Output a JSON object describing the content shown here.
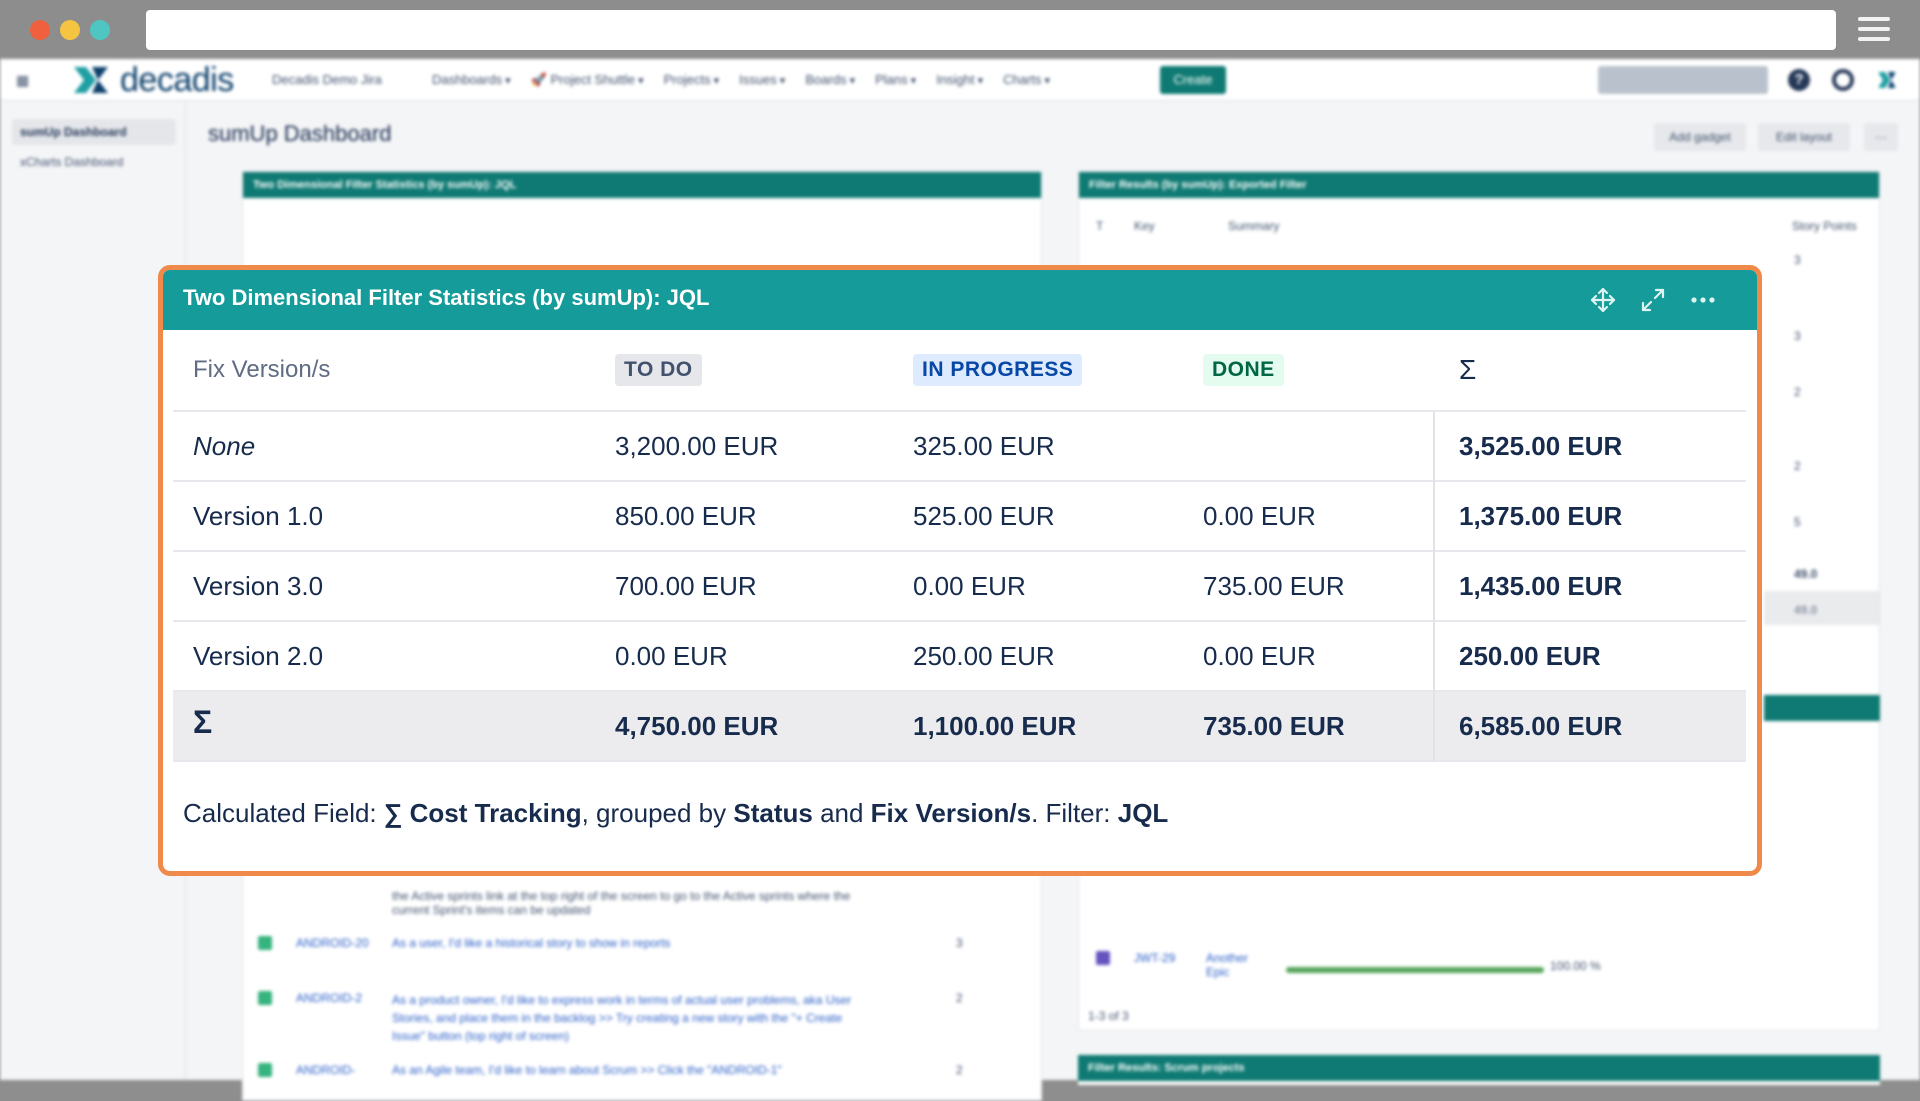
{
  "header": {
    "site_name": "Decadis Demo Jira",
    "logo_text": "decadis",
    "nav": [
      "Dashboards",
      "🚀 Project Shuttle",
      "Projects",
      "Issues",
      "Boards",
      "Plans",
      "Insight",
      "Charts"
    ],
    "create_label": "Create"
  },
  "sidebar": {
    "items": [
      {
        "label": "sumUp Dashboard"
      },
      {
        "label": "xCharts Dashboard"
      }
    ]
  },
  "page": {
    "title": "sumUp Dashboard",
    "add_gadget_label": "Add gadget",
    "edit_layout_label": "Edit layout",
    "more_label": "···"
  },
  "background_gadgets": {
    "left_title": "Two Dimensional Filter Statistics (by sumUp): JQL",
    "right_title": "Filter Results (by sumUp): Exported Filter",
    "right_cols": [
      "T",
      "Key",
      "Summary",
      "Story Points"
    ],
    "bottom_right_title": "Filter Results: Scrum projects",
    "pagination": "1-3 of 3",
    "progress_pct": "100.00 %",
    "row_keys": [
      "ANDROID-20",
      "ANDROID-2",
      "ANDROID-",
      "JWT-29"
    ],
    "row_texts": [
      "the Active sprints link at the top right of the screen to go to the Active sprints where the current Sprint's items can be updated",
      "As a user, I'd like a historical story to show in reports",
      "As a product owner, I'd like to express work in terms of actual user problems, aka User Stories, and place them in the backlog >> Try creating a new story with the \"+ Create Issue\" button (top right of screen)",
      "As an Agile team, I'd like to learn about Scrum >> Click the \"ANDROID-1\"",
      "Another Epic"
    ],
    "right_points": [
      "3",
      "3",
      "2",
      "2",
      "5",
      "49.0",
      "49.0"
    ],
    "left_points": [
      "3",
      "2",
      "2"
    ]
  },
  "gadget": {
    "title": "Two Dimensional Filter Statistics (by sumUp): JQL",
    "columns": {
      "row_header": "Fix Version/s",
      "todo": "TO DO",
      "in_progress": "IN PROGRESS",
      "done": "DONE",
      "sum": "Σ"
    },
    "rows": [
      {
        "version": "None",
        "todo": "3,200.00 EUR",
        "in_progress": "325.00 EUR",
        "done": "",
        "sum": "3,525.00 EUR"
      },
      {
        "version": "Version 1.0",
        "todo": "850.00 EUR",
        "in_progress": "525.00 EUR",
        "done": "0.00 EUR",
        "sum": "1,375.00 EUR"
      },
      {
        "version": "Version 3.0",
        "todo": "700.00 EUR",
        "in_progress": "0.00 EUR",
        "done": "735.00 EUR",
        "sum": "1,435.00 EUR"
      },
      {
        "version": "Version 2.0",
        "todo": "0.00 EUR",
        "in_progress": "250.00 EUR",
        "done": "0.00 EUR",
        "sum": "250.00 EUR"
      }
    ],
    "totals": {
      "label": "Σ",
      "todo": "4,750.00 EUR",
      "in_progress": "1,100.00 EUR",
      "done": "735.00 EUR",
      "sum": "6,585.00 EUR"
    },
    "footer": {
      "prefix": "Calculated Field: ",
      "field": "∑ Cost Tracking",
      "mid1": ", grouped by ",
      "group1": "Status",
      "mid2": " and ",
      "group2": "Fix Version/s",
      "mid3": ". Filter: ",
      "filter": "JQL"
    },
    "icons": [
      "move-icon",
      "expand-icon",
      "more-icon"
    ]
  },
  "colors": {
    "gadget_header": "#159c9a",
    "highlight_border": "#f08a4b",
    "brand_teal": "#0f7a73"
  }
}
